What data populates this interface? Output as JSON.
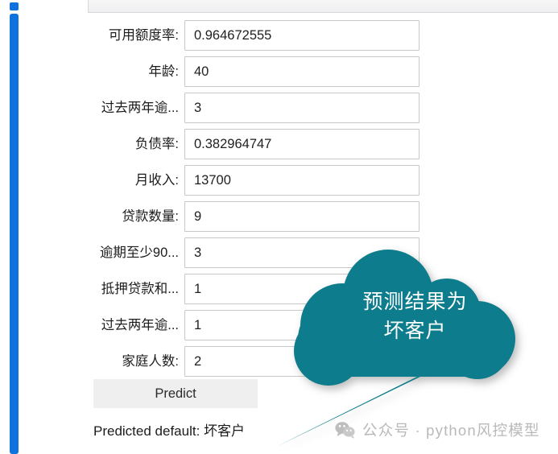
{
  "window": {
    "tab_label": "",
    "accent_blue": "#0f72dd",
    "callout_teal": "#0e7b8c"
  },
  "form": {
    "rows": [
      {
        "label": "可用额度率:",
        "value": "0.964672555"
      },
      {
        "label": "年龄:",
        "value": "40"
      },
      {
        "label": "过去两年逾...",
        "value": "3"
      },
      {
        "label": "负债率:",
        "value": "0.382964747"
      },
      {
        "label": "月收入:",
        "value": "13700"
      },
      {
        "label": "贷款数量:",
        "value": "9"
      },
      {
        "label": "逾期至少90...",
        "value": "3"
      },
      {
        "label": "抵押贷款和...",
        "value": "1"
      },
      {
        "label": "过去两年逾...",
        "value": "1"
      },
      {
        "label": "家庭人数:",
        "value": "2"
      }
    ],
    "submit_label": "Predict"
  },
  "result": {
    "text": "Predicted default: 坏客户"
  },
  "callout": {
    "line1": "预测结果为",
    "line2": "坏客户"
  },
  "watermark": {
    "icon": "wechat-icon",
    "text": "公众号 · python风控模型"
  }
}
